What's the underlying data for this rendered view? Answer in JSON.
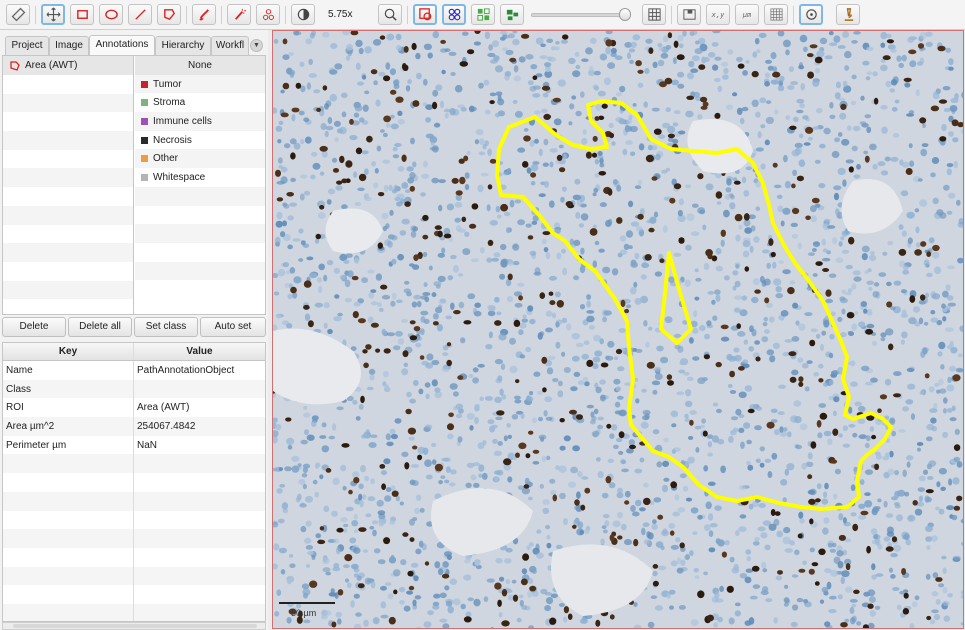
{
  "toolbar": {
    "zoom_label": "5.75x",
    "coords_label": "x,y",
    "units_label": "µm",
    "icons": [
      "ruler-icon",
      "move-icon",
      "rectangle-icon",
      "ellipse-icon",
      "line-icon",
      "polygon-icon",
      "brush-icon",
      "wand-icon",
      "points-icon",
      "contrast-icon",
      "zoom-fit-icon",
      "annotations-icon",
      "detections-icon",
      "fill-icon",
      "tma-icon",
      "grid-icon",
      "overview-icon",
      "coords-icon",
      "scalebar-icon",
      "pixel-grid-icon",
      "target-icon",
      "microscope-icon"
    ]
  },
  "tabs": [
    "Project",
    "Image",
    "Annotations",
    "Hierarchy",
    "Workfl"
  ],
  "annotations": {
    "items": [
      {
        "label": "Area (AWT)",
        "icon": "polygon-annotation-icon"
      }
    ],
    "classes": [
      {
        "name": "None",
        "color": ""
      },
      {
        "name": "Tumor",
        "color": "#c8232c"
      },
      {
        "name": "Stroma",
        "color": "#7fb27c"
      },
      {
        "name": "Immune cells",
        "color": "#a04fb6"
      },
      {
        "name": "Necrosis",
        "color": "#2a2a2a"
      },
      {
        "name": "Other",
        "color": "#ef9a44"
      },
      {
        "name": "Whitespace",
        "color": "#b4b4b4"
      }
    ],
    "buttons": [
      "Delete",
      "Delete all",
      "Set class",
      "Auto set"
    ]
  },
  "properties": {
    "headers": [
      "Key",
      "Value"
    ],
    "rows": [
      [
        "Name",
        "PathAnnotationObject"
      ],
      [
        "Class",
        ""
      ],
      [
        "ROI",
        "Area (AWT)"
      ],
      [
        "Area µm^2",
        "254067.4842"
      ],
      [
        "Perimeter µm",
        "NaN"
      ]
    ]
  },
  "viewer": {
    "scalebar_label": "50 µm",
    "annotation_color": "#ffff00",
    "background_tint": "#d9dde3"
  }
}
